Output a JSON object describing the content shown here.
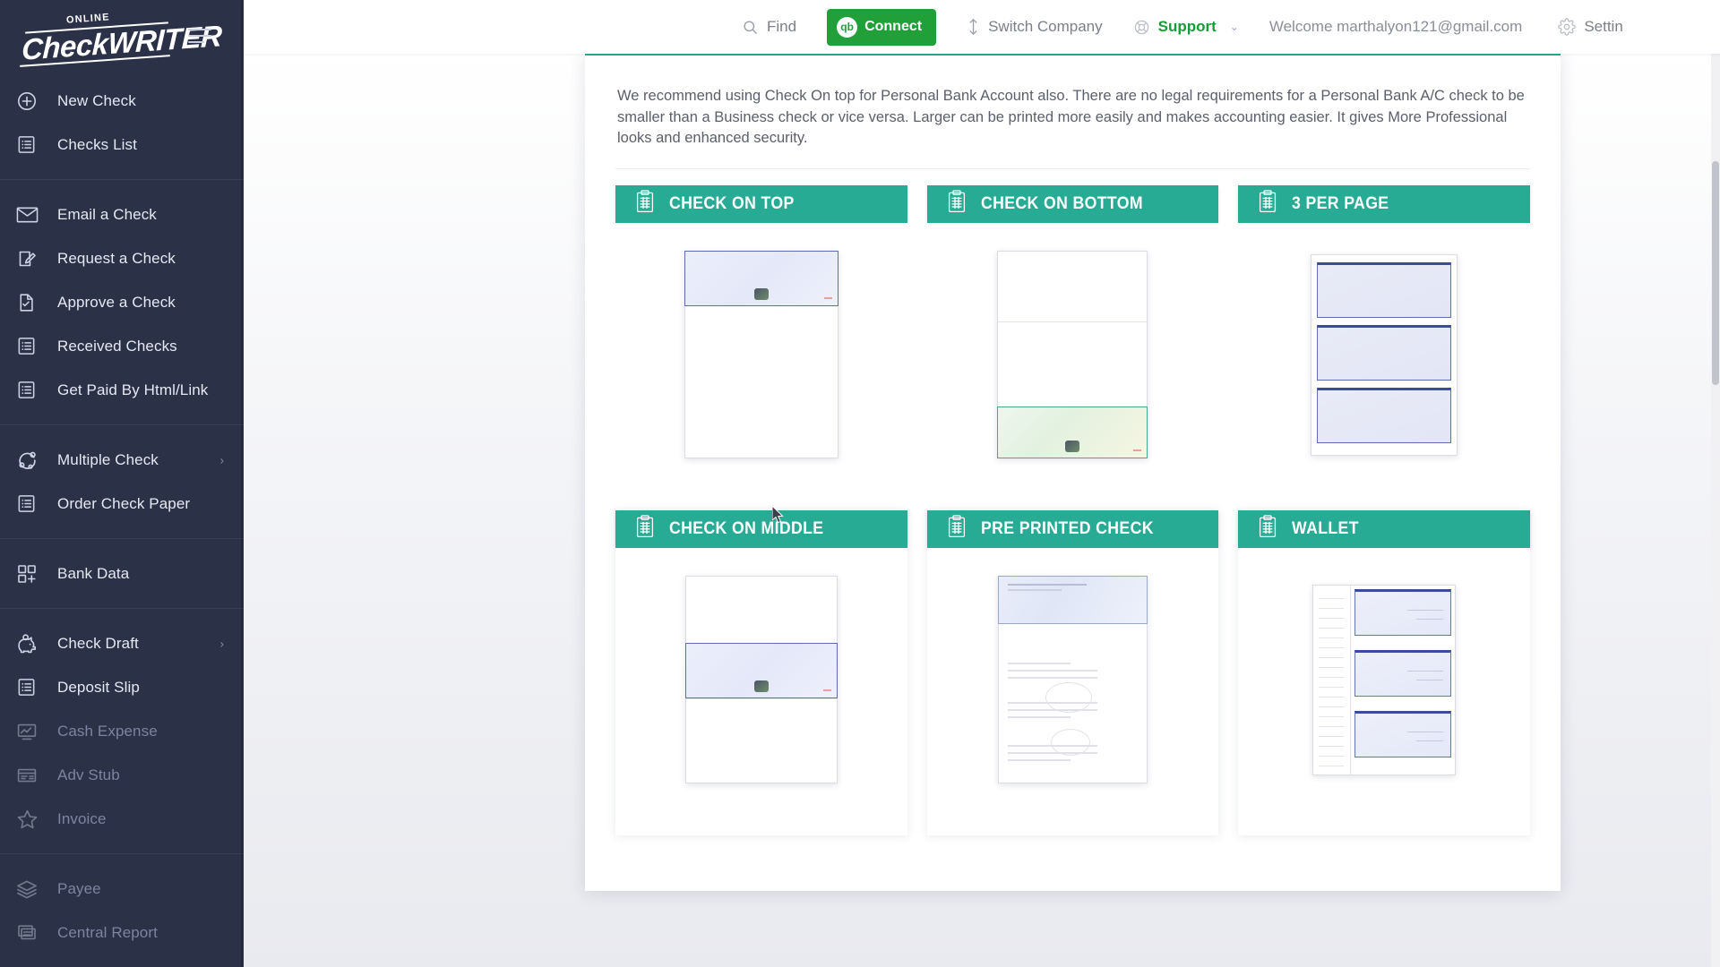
{
  "brand": {
    "online": "ONLINE",
    "name_part1": "Check",
    "name_part2": "WRITER"
  },
  "sidebar": {
    "groups": [
      {
        "items": [
          {
            "label": "New Check",
            "icon": "plus-circle-icon",
            "dim": false,
            "chevron": false
          },
          {
            "label": "Checks List",
            "icon": "list-icon",
            "dim": false,
            "chevron": false
          }
        ]
      },
      {
        "items": [
          {
            "label": "Email a Check",
            "icon": "envelope-icon",
            "dim": false,
            "chevron": false
          },
          {
            "label": "Request a Check",
            "icon": "request-pen-icon",
            "dim": false,
            "chevron": false
          },
          {
            "label": "Approve a Check",
            "icon": "approve-doc-icon",
            "dim": false,
            "chevron": false
          },
          {
            "label": "Received Checks",
            "icon": "list-icon",
            "dim": false,
            "chevron": false
          },
          {
            "label": "Get Paid By Html/Link",
            "icon": "list-icon",
            "dim": false,
            "chevron": false
          }
        ]
      },
      {
        "items": [
          {
            "label": "Multiple Check",
            "icon": "multiple-check-icon",
            "dim": false,
            "chevron": true
          },
          {
            "label": "Order Check Paper",
            "icon": "list-icon",
            "dim": false,
            "chevron": false
          }
        ]
      },
      {
        "items": [
          {
            "label": "Bank Data",
            "icon": "bank-data-grid-icon",
            "dim": false,
            "chevron": false
          }
        ]
      },
      {
        "items": [
          {
            "label": "Check Draft",
            "icon": "piggy-bank-icon",
            "dim": false,
            "chevron": true
          },
          {
            "label": "Deposit Slip",
            "icon": "list-icon",
            "dim": false,
            "chevron": false
          },
          {
            "label": "Cash Expense",
            "icon": "cash-expense-icon",
            "dim": true,
            "chevron": false
          },
          {
            "label": "Adv Stub",
            "icon": "adv-stub-icon",
            "dim": true,
            "chevron": false
          },
          {
            "label": "Invoice",
            "icon": "star-icon",
            "dim": true,
            "chevron": false
          }
        ]
      },
      {
        "items": [
          {
            "label": "Payee",
            "icon": "layers-icon",
            "dim": true,
            "chevron": false
          },
          {
            "label": "Central Report",
            "icon": "reports-icon",
            "dim": true,
            "chevron": false
          }
        ]
      }
    ]
  },
  "topbar": {
    "find": "Find",
    "connect": "Connect",
    "connect_badge": "qb",
    "switch_company": "Switch Company",
    "support": "Support",
    "welcome": "Welcome marthalyon121@gmail.com",
    "settings": "Settin",
    "colors": {
      "connect_green": "#21a03a",
      "support_green": "#169c36",
      "accent_teal": "#27ab95"
    }
  },
  "panel": {
    "intro": "We recommend using Check On top for Personal Bank Account also. There are no legal requirements for a Personal Bank A/C check to be smaller than a Business check or vice versa. Larger can be printed more easily and makes accounting easier. It gives More Professional looks and enhanced security.",
    "cards": [
      {
        "title": "CHECK ON TOP",
        "icon": "clipboard-icon",
        "layout": "top"
      },
      {
        "title": "CHECK ON BOTTOM",
        "icon": "clipboard-icon",
        "layout": "bottom"
      },
      {
        "title": "3 PER PAGE",
        "icon": "clipboard-icon",
        "layout": "three"
      },
      {
        "title": "CHECK ON MIDDLE",
        "icon": "clipboard-icon",
        "layout": "middle"
      },
      {
        "title": "PRE PRINTED CHECK",
        "icon": "clipboard-icon",
        "layout": "preprinted"
      },
      {
        "title": "WALLET",
        "icon": "clipboard-icon",
        "layout": "wallet"
      }
    ]
  }
}
